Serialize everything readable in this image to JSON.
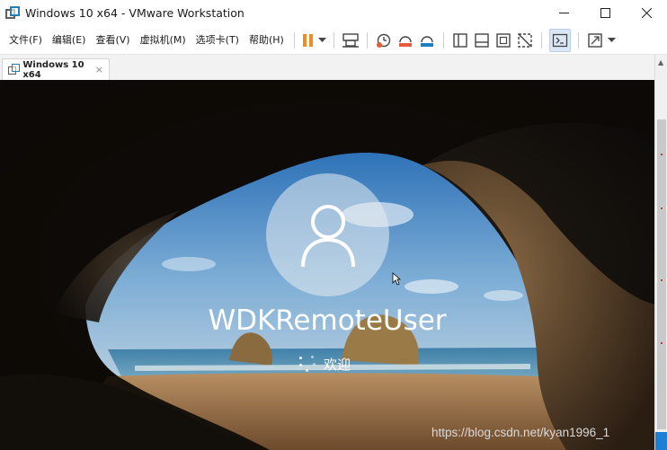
{
  "window": {
    "title": "Windows 10 x64 - VMware Workstation"
  },
  "menu": {
    "items": [
      "文件(F)",
      "编辑(E)",
      "查看(V)",
      "虚拟机(M)",
      "选项卡(T)",
      "帮助(H)"
    ]
  },
  "toolbar": {
    "icons": [
      "pause-icon",
      "dropdown-arrow-icon",
      "send-ctrl-alt-del-icon",
      "snapshot-icon",
      "revert-snapshot-icon",
      "snapshot-manager-icon",
      "library-view-icon",
      "thumbnail-bar-icon",
      "full-screen-icon",
      "unity-icon",
      "console-view-icon",
      "stretch-guest-icon"
    ]
  },
  "tab": {
    "label": "Windows 10 x64",
    "close": "×"
  },
  "lockscreen": {
    "username": "WDKRemoteUser",
    "status": "欢迎"
  },
  "watermark": {
    "text": "https://blog.csdn.net/kyan1996_1"
  },
  "colors": {
    "accent": "#1f7fd4",
    "pause": "#f08a24"
  }
}
